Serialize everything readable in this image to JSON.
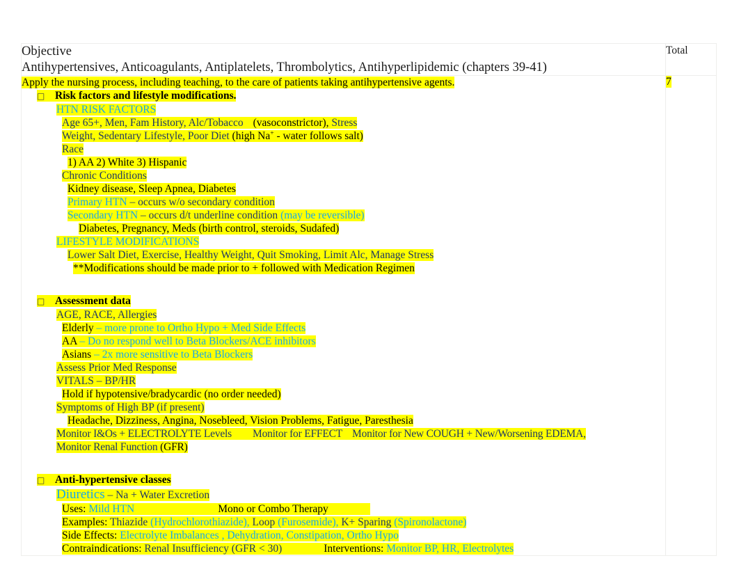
{
  "document": {
    "header": {
      "objective_label": "Objective",
      "objective_subtitle": "Antihypertensives, Anticoagulants, Antiplatelets, Thrombolytics, Antihyperlipidemic (chapters 39-41)",
      "total_label": "Total"
    },
    "total_value": "7",
    "objective_statement": "Apply the nursing process, including teaching, to the care of patients taking antihypertensive agents.",
    "bullet_glyph": "□",
    "sections": [
      {
        "bullet": "Risk factors and lifestyle modifications.",
        "heading_1": "HTN RISK FACTORS",
        "risk_line_1_a": "Age 65+, Men, Fam History, Alc/Tobacco",
        "risk_line_1_b": "(vasoconstrictor),",
        "risk_line_1_c": "Stress",
        "risk_line_2_a": "Weight, Sedentary Lifestyle, Poor Diet",
        "risk_line_2_b": "(high Na",
        "risk_line_2_sup": "+",
        "risk_line_2_c": " - water follows salt)",
        "race_label": "Race",
        "race_list": "1) AA   2) White   3) Hispanic",
        "chronic_label": "Chronic Conditions",
        "chronic_list": "Kidney disease, Sleep Apnea, Diabetes",
        "primary_htn_label": "Primary HTN",
        "primary_htn_desc": "– occurs w/o secondary condition",
        "secondary_htn_label": "Secondary HTN",
        "secondary_htn_desc": "– occurs d/t underline condition",
        "secondary_htn_note": "(may be reversible)",
        "secondary_htn_examples": "Diabetes, Pregnancy, Meds (birth control, steroids, Sudafed)",
        "heading_2": "LIFESTYLE MODIFICATIONS",
        "lifestyle_list": "Lower Salt Diet, Exercise, Healthy Weight, Quit Smoking, Limit Alc, Manage Stress",
        "lifestyle_note": "**Modifications should be made prior to + followed with Medication Regimen"
      },
      {
        "bullet": "Assessment data",
        "age_race_allergies": "AGE, RACE, Allergies",
        "elderly_label": "Elderly",
        "elderly_desc": "– more prone to Ortho Hypo + Med Side Effects",
        "aa_label": "AA",
        "aa_desc": "– Do no respond well to Beta Blockers/ACE inhibitors",
        "asians_label": "Asians",
        "asians_desc": "– 2x more sensitive to Beta Blockers",
        "assess_prior": "Assess Prior Med Response",
        "vitals": "VITALS – BP/HR",
        "vitals_note": "Hold if hypotensive/bradycardic (no order needed)",
        "symptoms_label": "Symptoms of High BP (if present)",
        "symptoms_list": "Headache, Dizziness, Angina, Nosebleed, Vision Problems, Fatigue, Paresthesia",
        "monitor_1": "Monitor I&Os + ELECTROLYTE Levels",
        "monitor_2": "Monitor for EFFECT",
        "monitor_3": "Monitor for New COUGH + New/Worsening EDEMA,",
        "monitor_4": "Monitor Renal Function",
        "monitor_4_note": "(GFR)"
      },
      {
        "bullet": "Anti-hypertensive classes",
        "drug_class": "Diuretics",
        "drug_class_desc": "– Na + Water Excretion",
        "uses_label": "Uses:",
        "uses_value": "Mild HTN",
        "therapy_note": "Mono or Combo Therapy",
        "examples_label": "Examples:",
        "examples_1_name": "Thiazide",
        "examples_1_drug": "(Hydrochlorothiazide),",
        "examples_2_name": "Loop",
        "examples_2_drug": "(Furosemide),",
        "examples_3_name": "K+ Sparing",
        "examples_3_drug": "(Spironolactone)",
        "side_effects_label": "Side Effects:",
        "side_effects_1": "Electrolyte Imbalances",
        "side_effects_comma": ",",
        "side_effects_2": "Dehydration, Constipation, Ortho Hypo",
        "contraindications_label": "Contraindications:",
        "contraindications_value": "Renal Insufficiency (GFR < 30)",
        "interventions_label": "Interventions:",
        "interventions_value": "Monitor BP, HR, Electrolytes"
      }
    ]
  },
  "colors": {
    "highlight": "#ffff00",
    "cyan": "#18a8e8",
    "dark_blue": "#1f3864",
    "text": "#000000"
  }
}
